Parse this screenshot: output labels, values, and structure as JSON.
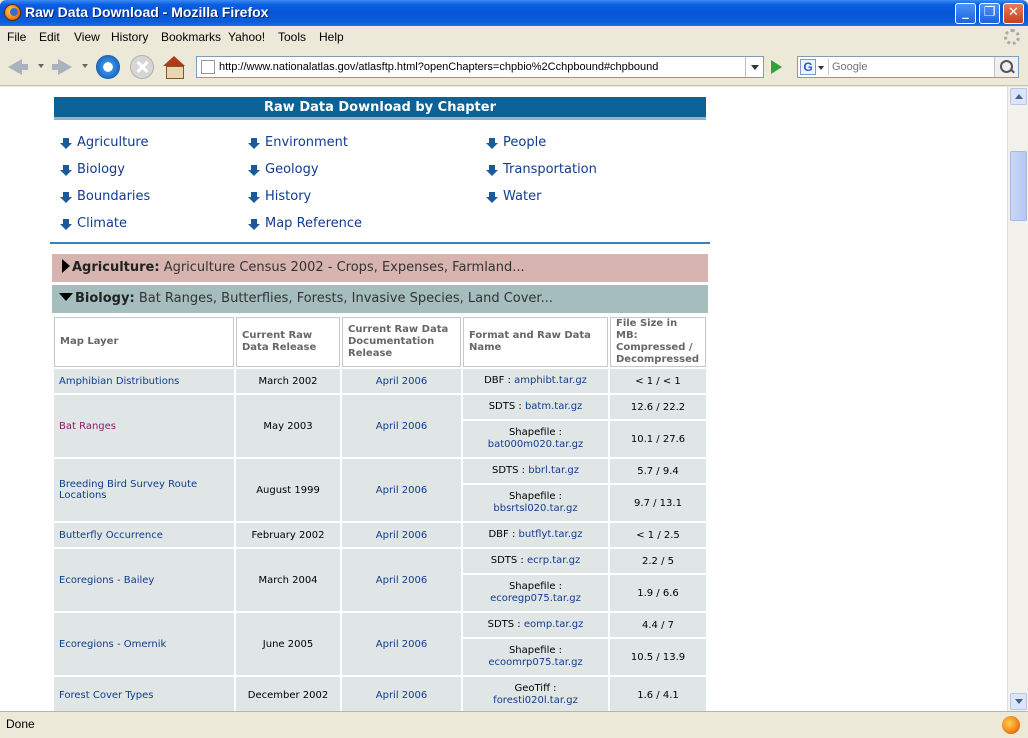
{
  "window": {
    "title": "Raw Data Download - Mozilla Firefox"
  },
  "menu": [
    "File",
    "Edit",
    "View",
    "History",
    "Bookmarks",
    "Yahoo!",
    "Tools",
    "Help"
  ],
  "nav": {
    "url": "http://www.nationalatlas.gov/atlasftp.html?openChapters=chpbio%2Cchpbound#chpbound",
    "search_placeholder": "Google",
    "search_engine_letter": "G"
  },
  "page": {
    "header": "Raw Data Download by Chapter",
    "chapters": {
      "col1": [
        "Agriculture",
        "Biology",
        "Boundaries",
        "Climate"
      ],
      "col2": [
        "Environment",
        "Geology",
        "History",
        "Map Reference"
      ],
      "col3": [
        "People",
        "Transportation",
        "Water"
      ]
    },
    "agriculture": {
      "label": "Agriculture:",
      "desc": "Agriculture Census 2002 - Crops, Expenses, Farmland..."
    },
    "biology": {
      "label": "Biology:",
      "desc": "Bat Ranges, Butterflies, Forests, Invasive Species, Land Cover..."
    },
    "table": {
      "headers": [
        "Map Layer",
        "Current Raw Data Release",
        "Current Raw Data Documentation Release",
        "Format and Raw Data Name",
        "File Size in MB: Compressed / Decompressed"
      ],
      "rows": [
        {
          "name": "Amphibian Distributions",
          "release": "March 2002",
          "doc": "April 2006",
          "files": [
            {
              "fmt": "DBF :",
              "file": "amphibt.tar.gz",
              "size": "< 1 / < 1"
            }
          ]
        },
        {
          "name": "Bat Ranges",
          "release": "May 2003",
          "doc": "April 2006",
          "files": [
            {
              "fmt": "SDTS :",
              "file": "batm.tar.gz",
              "size": "12.6 / 22.2"
            },
            {
              "fmt": "Shapefile :",
              "file": "bat000m020.tar.gz",
              "size": "10.1 / 27.6"
            }
          ]
        },
        {
          "name": "Breeding Bird Survey Route Locations",
          "release": "August 1999",
          "doc": "April 2006",
          "files": [
            {
              "fmt": "SDTS :",
              "file": "bbrl.tar.gz",
              "size": "5.7 / 9.4"
            },
            {
              "fmt": "Shapefile :",
              "file": "bbsrtsl020.tar.gz",
              "size": "9.7 / 13.1"
            }
          ]
        },
        {
          "name": "Butterfly Occurrence",
          "release": "February 2002",
          "doc": "April 2006",
          "files": [
            {
              "fmt": "DBF :",
              "file": "butflyt.tar.gz",
              "size": "< 1 / 2.5"
            }
          ]
        },
        {
          "name": "Ecoregions - Bailey",
          "release": "March 2004",
          "doc": "April 2006",
          "files": [
            {
              "fmt": "SDTS :",
              "file": "ecrp.tar.gz",
              "size": "2.2 / 5"
            },
            {
              "fmt": "Shapefile :",
              "file": "ecoregp075.tar.gz",
              "size": "1.9 / 6.6"
            }
          ]
        },
        {
          "name": "Ecoregions - Omernik",
          "release": "June 2005",
          "doc": "April 2006",
          "files": [
            {
              "fmt": "SDTS :",
              "file": "eomp.tar.gz",
              "size": "4.4 / 7"
            },
            {
              "fmt": "Shapefile :",
              "file": "ecoomrp075.tar.gz",
              "size": "10.5 / 13.9"
            }
          ]
        },
        {
          "name": "Forest Cover Types",
          "release": "December 2002",
          "doc": "April 2006",
          "files": [
            {
              "fmt": "GeoTiff :",
              "file": "foresti020l.tar.gz",
              "size": "1.6 / 4.1"
            }
          ]
        }
      ]
    }
  },
  "status": {
    "text": "Done"
  }
}
